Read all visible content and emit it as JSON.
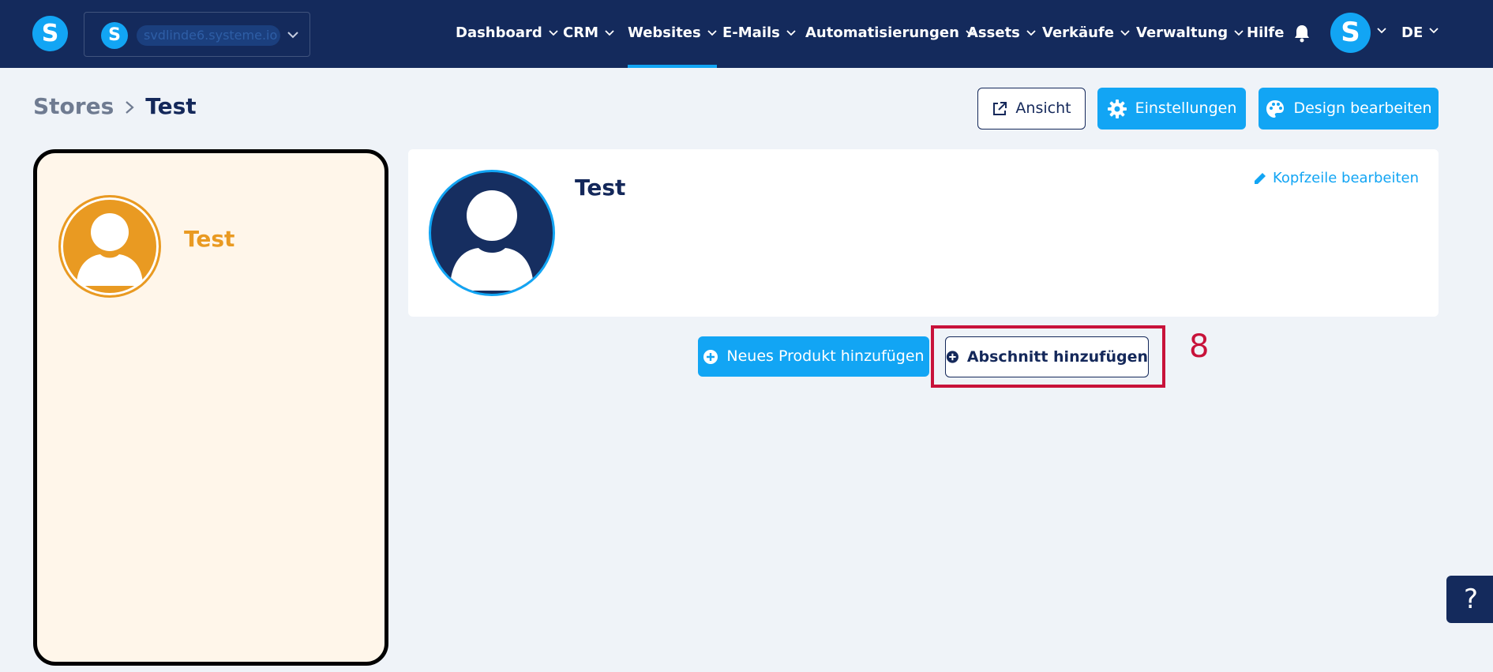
{
  "brand": {
    "logo_letter": "S",
    "workspace_letter": "S",
    "workspace_name": "svdlinde6.systeme.io"
  },
  "nav": {
    "items": [
      {
        "label": "Dashboard",
        "dropdown": true,
        "active": false
      },
      {
        "label": "CRM",
        "dropdown": true,
        "active": false
      },
      {
        "label": "Websites",
        "dropdown": true,
        "active": true
      },
      {
        "label": "E-Mails",
        "dropdown": true,
        "active": false
      },
      {
        "label": "Automatisierungen",
        "dropdown": true,
        "active": false
      },
      {
        "label": "Assets",
        "dropdown": true,
        "active": false
      },
      {
        "label": "Verkäufe",
        "dropdown": true,
        "active": false
      },
      {
        "label": "Verwaltung",
        "dropdown": true,
        "active": false
      },
      {
        "label": "Hilfe",
        "dropdown": false,
        "active": false
      }
    ],
    "icons": {
      "bell": "bell-icon"
    },
    "user_letter": "S",
    "language": "DE"
  },
  "breadcrumb": {
    "parent": "Stores",
    "current": "Test"
  },
  "toolbar": {
    "view_label": "Ansicht",
    "settings_label": "Einstellungen",
    "design_label": "Design bearbeiten"
  },
  "preview": {
    "title": "Test"
  },
  "header_card": {
    "title": "Test",
    "edit_label": "Kopfzeile bearbeiten"
  },
  "actions": {
    "add_product_label": "Neues Produkt hinzufügen",
    "add_section_label": "Abschnitt hinzufügen"
  },
  "annotation": {
    "step": "8"
  },
  "help": {
    "label": "?"
  },
  "colors": {
    "nav_bg": "#142a5c",
    "accent": "#12a5f4",
    "page_bg": "#eff3f8",
    "preview_bg": "#fff6ea",
    "preview_accent": "#e99a22",
    "highlight": "#c8123a"
  }
}
